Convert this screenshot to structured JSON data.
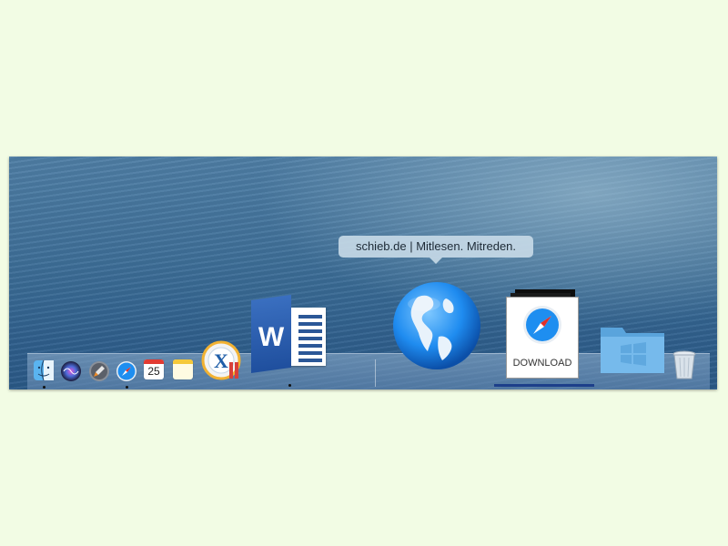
{
  "tooltip": {
    "text": "schieb.de | Mitlesen. Mitreden."
  },
  "dock": {
    "apps": [
      {
        "name": "Finder",
        "icon": "finder-icon",
        "running": true
      },
      {
        "name": "Siri",
        "icon": "siri-icon",
        "running": false
      },
      {
        "name": "Launchpad",
        "icon": "launchpad-icon",
        "running": false
      },
      {
        "name": "Safari",
        "icon": "safari-icon",
        "running": true
      },
      {
        "name": "Calendar",
        "icon": "calendar-icon",
        "running": false,
        "date": "25"
      },
      {
        "name": "Notes",
        "icon": "notes-icon",
        "running": false
      },
      {
        "name": "XML Editor",
        "icon": "x-app-icon",
        "running": false,
        "label": "X"
      },
      {
        "name": "Microsoft Word",
        "icon": "word-icon",
        "running": true,
        "label": "W"
      },
      {
        "name": "Website",
        "icon": "globe-icon",
        "running": false
      },
      {
        "name": "Downloads",
        "icon": "download-stack-icon",
        "running": false,
        "label": "DOWNLOAD",
        "progress": 1.0
      },
      {
        "name": "Windows Folder",
        "icon": "windows-folder-icon",
        "running": false
      },
      {
        "name": "Trash",
        "icon": "trash-icon",
        "running": false
      }
    ]
  },
  "colors": {
    "page_bg": "#f2fce4",
    "tooltip_bg": "#c8dae8",
    "progress": "#1d3f8a"
  }
}
